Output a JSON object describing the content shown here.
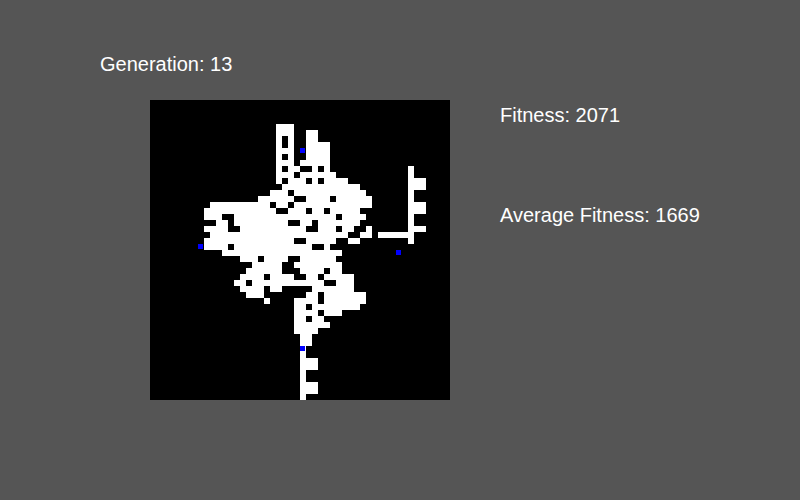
{
  "header": {
    "generation": "Generation: 13"
  },
  "stats": {
    "fitness": "Fitness: 2071",
    "average_fitness": "Average Fitness: 1669"
  },
  "grid": {
    "cols": 50,
    "rows": 50,
    "runs": [
      [
        4,
        21,
        3
      ],
      [
        5,
        21,
        3
      ],
      [
        5,
        26,
        2
      ],
      [
        6,
        21,
        1
      ],
      [
        6,
        23,
        1
      ],
      [
        6,
        26,
        2
      ],
      [
        7,
        21,
        1
      ],
      [
        7,
        23,
        1
      ],
      [
        7,
        26,
        4
      ],
      [
        8,
        21,
        3
      ],
      [
        8,
        26,
        4
      ],
      [
        9,
        21,
        1
      ],
      [
        9,
        23,
        1
      ],
      [
        9,
        26,
        4
      ],
      [
        10,
        21,
        3
      ],
      [
        10,
        25,
        5
      ],
      [
        11,
        21,
        1
      ],
      [
        11,
        23,
        2
      ],
      [
        11,
        27,
        1
      ],
      [
        11,
        29,
        1
      ],
      [
        11,
        43,
        1
      ],
      [
        12,
        21,
        3
      ],
      [
        12,
        25,
        6
      ],
      [
        12,
        43,
        1
      ],
      [
        13,
        21,
        1
      ],
      [
        13,
        23,
        3
      ],
      [
        13,
        27,
        1
      ],
      [
        13,
        29,
        4
      ],
      [
        13,
        43,
        3
      ],
      [
        14,
        22,
        13
      ],
      [
        14,
        43,
        3
      ],
      [
        15,
        20,
        3
      ],
      [
        15,
        24,
        12
      ],
      [
        15,
        43,
        1
      ],
      [
        16,
        18,
        6
      ],
      [
        16,
        26,
        4
      ],
      [
        16,
        31,
        6
      ],
      [
        16,
        43,
        1
      ],
      [
        17,
        10,
        10
      ],
      [
        17,
        21,
        2
      ],
      [
        17,
        24,
        13
      ],
      [
        17,
        43,
        3
      ],
      [
        18,
        9,
        12
      ],
      [
        18,
        23,
        3
      ],
      [
        18,
        27,
        2
      ],
      [
        18,
        30,
        5
      ],
      [
        18,
        43,
        3
      ],
      [
        19,
        9,
        3
      ],
      [
        19,
        14,
        17
      ],
      [
        19,
        32,
        4
      ],
      [
        19,
        43,
        1
      ],
      [
        20,
        11,
        2
      ],
      [
        20,
        14,
        9
      ],
      [
        20,
        25,
        2
      ],
      [
        20,
        28,
        7
      ],
      [
        20,
        43,
        1
      ],
      [
        21,
        9,
        4
      ],
      [
        21,
        15,
        11
      ],
      [
        21,
        28,
        3
      ],
      [
        21,
        32,
        2
      ],
      [
        21,
        36,
        1
      ],
      [
        21,
        43,
        3
      ],
      [
        22,
        10,
        23
      ],
      [
        22,
        35,
        2
      ],
      [
        22,
        38,
        6
      ],
      [
        23,
        9,
        15
      ],
      [
        23,
        26,
        5
      ],
      [
        23,
        33,
        2
      ],
      [
        23,
        43,
        1
      ],
      [
        24,
        9,
        4
      ],
      [
        24,
        14,
        13
      ],
      [
        24,
        29,
        1
      ],
      [
        25,
        12,
        20
      ],
      [
        26,
        15,
        3
      ],
      [
        26,
        19,
        4
      ],
      [
        26,
        25,
        6
      ],
      [
        27,
        17,
        3
      ],
      [
        27,
        20,
        2
      ],
      [
        27,
        24,
        8
      ],
      [
        28,
        16,
        6
      ],
      [
        28,
        25,
        4
      ],
      [
        28,
        30,
        2
      ],
      [
        29,
        15,
        4
      ],
      [
        29,
        20,
        4
      ],
      [
        29,
        26,
        2
      ],
      [
        29,
        29,
        5
      ],
      [
        30,
        14,
        2
      ],
      [
        30,
        17,
        12
      ],
      [
        30,
        31,
        3
      ],
      [
        31,
        15,
        4
      ],
      [
        31,
        20,
        2
      ],
      [
        31,
        27,
        7
      ],
      [
        32,
        16,
        3
      ],
      [
        32,
        26,
        2
      ],
      [
        32,
        29,
        7
      ],
      [
        33,
        19,
        1
      ],
      [
        33,
        24,
        4
      ],
      [
        33,
        29,
        7
      ],
      [
        34,
        24,
        2
      ],
      [
        34,
        27,
        8
      ],
      [
        35,
        24,
        4
      ],
      [
        35,
        29,
        3
      ],
      [
        36,
        24,
        2
      ],
      [
        36,
        27,
        2
      ],
      [
        37,
        24,
        6
      ],
      [
        38,
        24,
        4
      ],
      [
        39,
        25,
        2
      ],
      [
        40,
        25,
        2
      ],
      [
        41,
        25,
        1
      ],
      [
        42,
        25,
        1
      ],
      [
        43,
        25,
        3
      ],
      [
        44,
        25,
        3
      ],
      [
        45,
        25,
        1
      ],
      [
        46,
        25,
        1
      ],
      [
        47,
        25,
        3
      ],
      [
        48,
        25,
        3
      ],
      [
        49,
        25,
        1
      ]
    ]
  },
  "agents": [
    {
      "col": 25,
      "row": 8
    },
    {
      "col": 8,
      "row": 24
    },
    {
      "col": 41,
      "row": 25
    },
    {
      "col": 25,
      "row": 41
    }
  ]
}
